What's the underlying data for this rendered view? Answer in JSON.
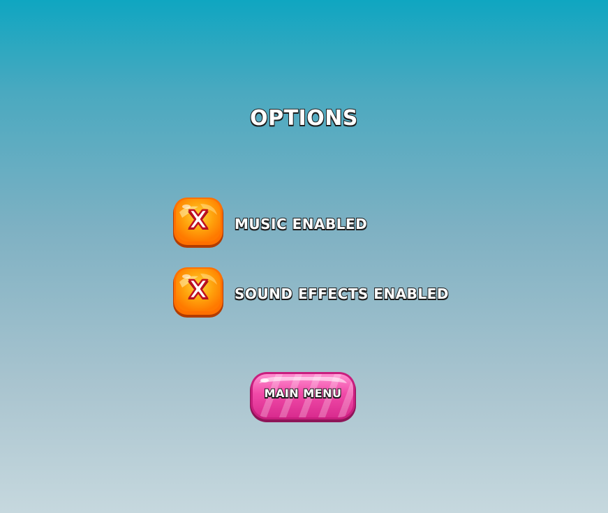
{
  "screen": {
    "title": "OPTIONS"
  },
  "options": [
    {
      "label": "MUSIC ENABLED",
      "icon": "close-x-icon",
      "enabled": false
    },
    {
      "label": "SOUND EFFECTS ENABLED",
      "icon": "close-x-icon",
      "enabled": false
    }
  ],
  "main_menu": {
    "label": "MAIN MENU"
  },
  "colors": {
    "background_top": "#0fa6c1",
    "background_bottom": "#c6d8de",
    "toggle_orange": "#ff8a00",
    "button_pink": "#e8399a",
    "text_outline": "#1b1b1b"
  }
}
